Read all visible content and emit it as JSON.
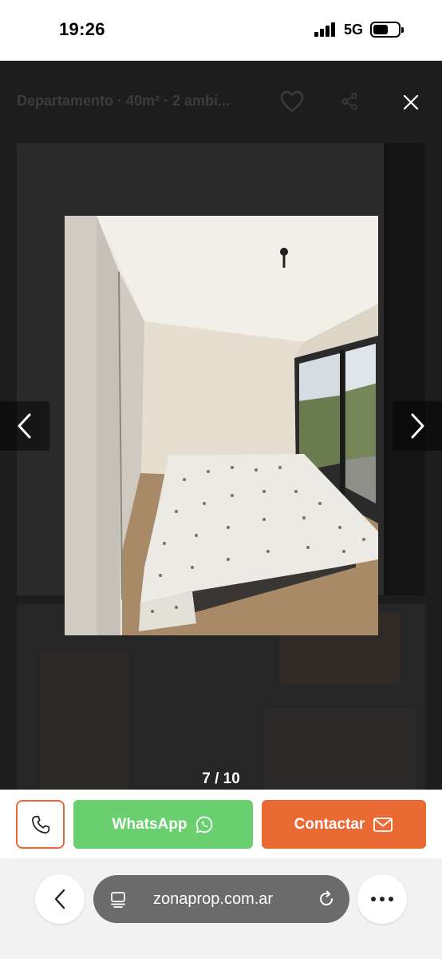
{
  "status_bar": {
    "time": "19:26",
    "network": "5G",
    "signal_icon": "cellular-signal-icon",
    "battery_icon": "battery-icon"
  },
  "viewer": {
    "title": "Departamento · 40m² · 2 ambi...",
    "favorite_icon": "heart-icon",
    "share_icon": "share-icon",
    "close_icon": "close-icon",
    "prev_icon": "chevron-left-icon",
    "next_icon": "chevron-right-icon",
    "counter": "7 / 10",
    "photo_current": 7,
    "photo_total": 10
  },
  "contact": {
    "call_icon": "phone-icon",
    "whatsapp_label": "WhatsApp",
    "whatsapp_icon": "whatsapp-icon",
    "contact_label": "Contactar",
    "contact_icon": "mail-icon",
    "accent_color": "#eb6a34",
    "whatsapp_color": "#69cf6f"
  },
  "browser": {
    "back_icon": "chevron-left-icon",
    "url": "zonaprop.com.ar",
    "tabs_icon": "tabs-icon",
    "reload_icon": "reload-icon",
    "more_icon": "more-icon"
  }
}
